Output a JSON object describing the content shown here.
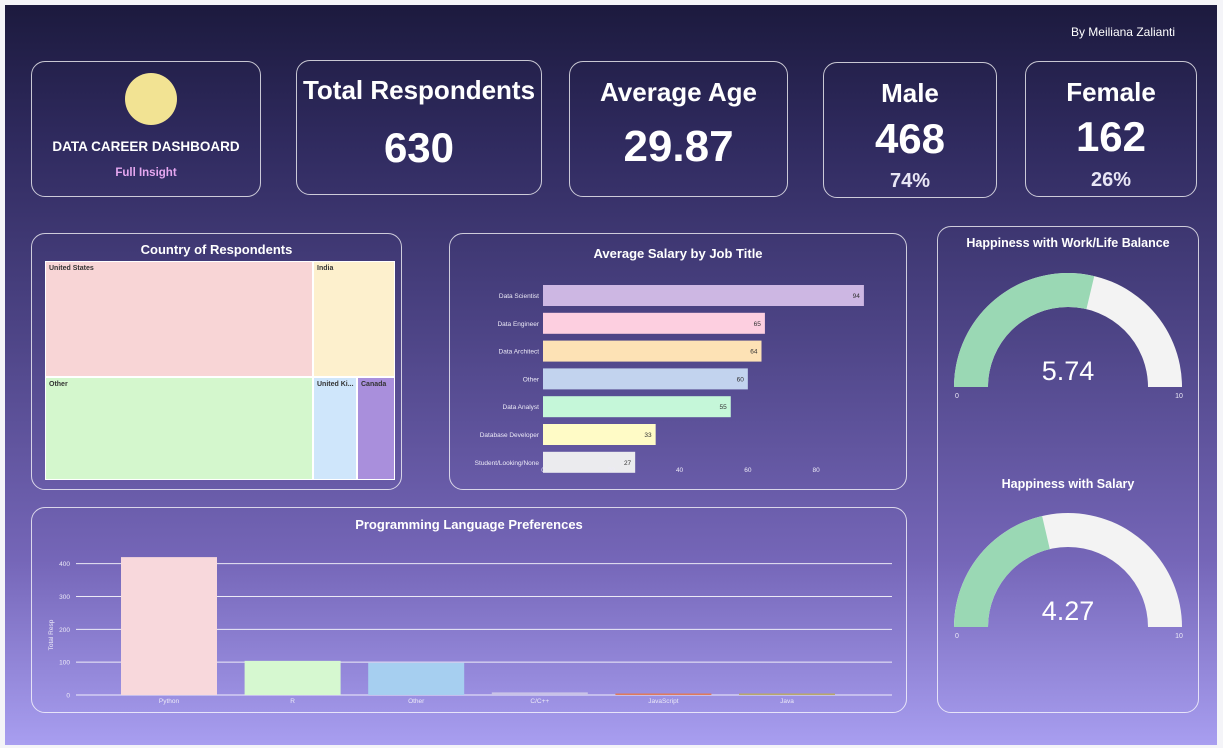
{
  "author": "By Meiliana Zalianti",
  "brand": {
    "title": "DATA CAREER DASHBOARD",
    "subtitle": "Full Insight",
    "logo_color": "#f2e393"
  },
  "kpis": {
    "total": {
      "title": "Total Respondents",
      "value": "630"
    },
    "age": {
      "title": "Average Age",
      "value": "29.87"
    },
    "male": {
      "title": "Male",
      "value": "468",
      "pct": "74%"
    },
    "female": {
      "title": "Female",
      "value": "162",
      "pct": "26%"
    }
  },
  "treemap": {
    "title": "Country of Respondents",
    "cells": [
      {
        "label": "United States",
        "color": "#f8d5d6"
      },
      {
        "label": "India",
        "color": "#fdf0cd"
      },
      {
        "label": "Other",
        "color": "#d4f7cd"
      },
      {
        "label": "United Ki...",
        "color": "#cfe6fb"
      },
      {
        "label": "Canada",
        "color": "#a98fdc"
      }
    ]
  },
  "salary": {
    "title": "Average Salary by Job Title",
    "ticks": [
      "0",
      "20",
      "40",
      "60",
      "80"
    ]
  },
  "languages": {
    "title": "Programming Language Preferences",
    "ylabel": "Total Resp",
    "ticks": [
      "0",
      "100",
      "200",
      "300",
      "400"
    ]
  },
  "gauges": [
    {
      "title": "Happiness with Work/Life Balance",
      "value": 5.74,
      "value_text": "5.74",
      "min": "0",
      "max": "10"
    },
    {
      "title": "Happiness with Salary",
      "value": 4.27,
      "value_text": "4.27",
      "min": "0",
      "max": "10"
    }
  ],
  "colors": {
    "gauge_fill": "#9ad8b4",
    "gauge_track": "#f3f3f3"
  },
  "chart_data": [
    {
      "type": "bar",
      "orientation": "horizontal",
      "title": "Average Salary by Job Title",
      "categories": [
        "Data Scientist",
        "Data Engineer",
        "Data Architect",
        "Other",
        "Data Analyst",
        "Database Developer",
        "Student/Looking/None"
      ],
      "values": [
        94,
        65,
        64,
        60,
        55,
        33,
        27
      ],
      "colors": [
        "#cdb7e3",
        "#fdcfe0",
        "#fde2b5",
        "#c2d3ee",
        "#c5f7d9",
        "#fffbc6",
        "#ebebee"
      ],
      "xlim": [
        0,
        100
      ]
    },
    {
      "type": "bar",
      "title": "Programming Language Preferences",
      "ylabel": "Total Resp",
      "categories": [
        "Python",
        "R",
        "Other",
        "C/C++",
        "JavaScript",
        "Java"
      ],
      "values": [
        420,
        104,
        98,
        8,
        4,
        2
      ],
      "colors": [
        "#f8d8dc",
        "#d6f8d0",
        "#a6cff0",
        "#c9c3e8",
        "#e07a5a",
        "#b9a86a"
      ],
      "ylim": [
        0,
        420
      ]
    }
  ]
}
